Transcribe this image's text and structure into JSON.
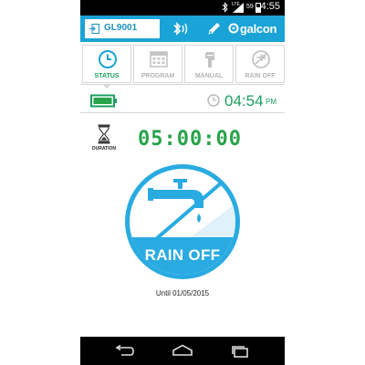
{
  "status_bar": {
    "network_label": "LTE",
    "battery_percent": "59",
    "time": "4:55"
  },
  "header": {
    "device_name": "GL9001",
    "brand": "galcon"
  },
  "tabs": [
    {
      "label": "STATUS",
      "active": true,
      "icon": "clock-icon"
    },
    {
      "label": "PROGRAM",
      "active": false,
      "icon": "calendar-icon"
    },
    {
      "label": "MANUAL",
      "active": false,
      "icon": "hand-icon"
    },
    {
      "label": "RAIN OFF",
      "active": false,
      "icon": "rain-off-icon"
    }
  ],
  "status": {
    "controller_time": "04:54",
    "controller_ampm": "PM",
    "duration_label": "DURATION",
    "duration_value": "05:00:00",
    "rain_off_label": "RAIN OFF",
    "until_text": "Until 01/05/2015"
  },
  "colors": {
    "header_blue": "#1aa3d6",
    "accent_green": "#1a9f5f",
    "badge_blue": "#29abe2",
    "inactive_gray": "#b4b4b4"
  }
}
